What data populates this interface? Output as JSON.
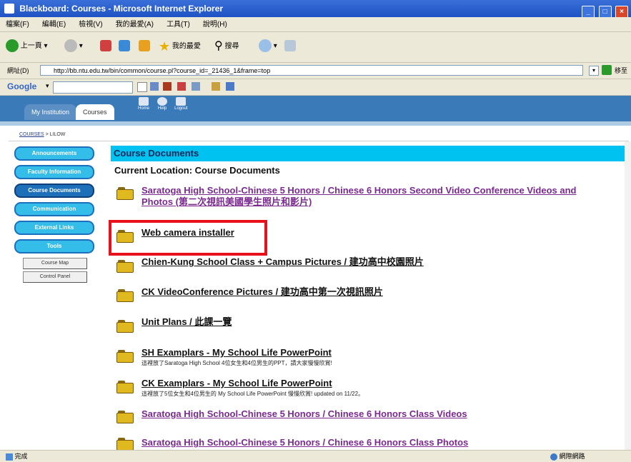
{
  "window": {
    "title": "Blackboard: Courses - Microsoft Internet Explorer",
    "controls": [
      "_",
      "□",
      "×"
    ]
  },
  "menu": [
    "檔案(F)",
    "編輯(E)",
    "檢視(V)",
    "我的最愛(A)",
    "工具(T)",
    "說明(H)"
  ],
  "toolbar": {
    "back_label": "上一頁",
    "favorites_label": "我的最愛",
    "search_label": "搜尋"
  },
  "address": {
    "label": "網址(D)",
    "url": "http://bb.ntu.edu.tw/bin/common/course.pl?course_id=_21436_1&frame=top",
    "go_label": "移至"
  },
  "google": {
    "label": "Google"
  },
  "bb": {
    "tabs": [
      "My Institution",
      "Courses"
    ],
    "nav": [
      "Home",
      "Help",
      "Logout"
    ]
  },
  "breadcrumb": {
    "courses": "COURSES",
    "sep": " > ",
    "current": "LILOW"
  },
  "sidebar": {
    "buttons": [
      "Announcements",
      "Faculty Information",
      "Course Documents",
      "Communication",
      "External Links",
      "Tools"
    ],
    "small_buttons": [
      "Course Map",
      "Control Panel"
    ]
  },
  "content": {
    "header": "Course Documents",
    "current_location": "Current Location: Course Documents",
    "items": [
      {
        "title": "Saratoga High School-Chinese 5 Honors / Chinese 6 Honors Second Video Conference Videos and",
        "title2": "Photos (第二次視訊美國學生照片和影片)",
        "desc": ""
      },
      {
        "title": "Web camera installer",
        "desc": ""
      },
      {
        "title": "Chien-Kung School Class + Campus Pictures / 建功高中校園照片",
        "desc": ""
      },
      {
        "title": "CK VideoConference Pictures / 建功高中第一次視訊照片",
        "desc": ""
      },
      {
        "title": "Unit Plans / 此課一覽",
        "desc": ""
      },
      {
        "title": "SH Examplars - My School Life PowerPoint",
        "desc": "這裡放了Saratoga High School 4位女生和4位男生的PPT，請大家慢慢欣賞!"
      },
      {
        "title": "CK Examplars - My School Life PowerPoint",
        "desc": "這裡放了5位女生和4位男生的 My School Life PowerPoint 慢慢欣賞! updated on 11/22。"
      },
      {
        "title": "Saratoga High School-Chinese 5 Honors / Chinese 6 Honors Class Videos",
        "desc": ""
      },
      {
        "title": "Saratoga High School-Chinese 5 Honors / Chinese 6 Honors Class Photos",
        "desc": ""
      }
    ]
  },
  "status": {
    "left": "完成",
    "right": "網際網路"
  }
}
